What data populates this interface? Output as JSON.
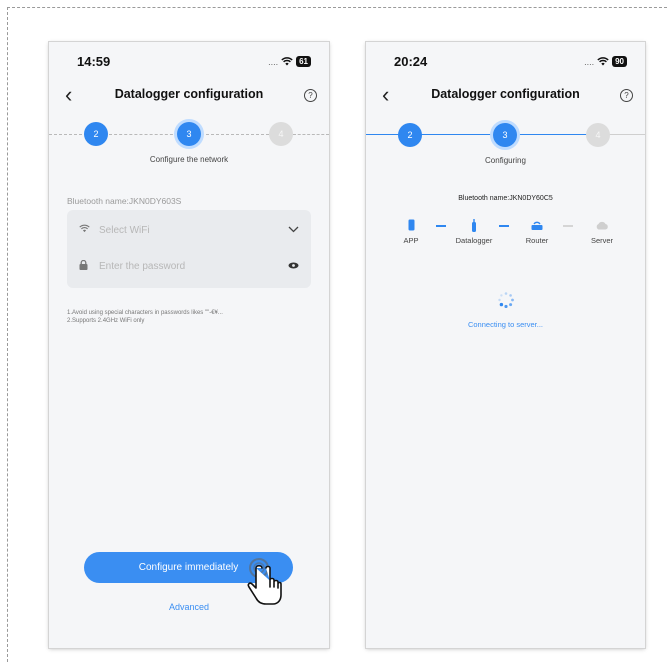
{
  "left_phone": {
    "status_time": "14:59",
    "battery": "61",
    "title": "Datalogger configuration",
    "steps": [
      "2",
      "3",
      "4"
    ],
    "step_label": "Configure the network",
    "bluetooth_name": "Bluetooth name:JKN0DY603S",
    "wifi_placeholder": "Select WiFi",
    "password_placeholder": "Enter the password",
    "note_line1": "1.Avoid using special characters in passwords likes \"\"-€¥...",
    "note_line2": "2.Supports 2.4GHz WiFi only",
    "configure_button": "Configure immediately",
    "advanced_link": "Advanced"
  },
  "right_phone": {
    "status_time": "20:24",
    "battery": "90",
    "title": "Datalogger configuration",
    "steps": [
      "2",
      "3",
      "4"
    ],
    "step_label": "Configuring",
    "bluetooth_name": "Bluetooth name:JKN0DY60C5",
    "nodes": [
      "APP",
      "Datalogger",
      "Router",
      "Server"
    ],
    "connecting_text": "Connecting to server..."
  },
  "colors": {
    "accent": "#2f87f0",
    "inactive": "#dcdcdc"
  },
  "icons": [
    "chevron-left-icon",
    "help-icon",
    "wifi-icon",
    "lock-icon",
    "chevron-down-icon",
    "eye-icon",
    "phone-icon",
    "datalogger-icon",
    "router-icon",
    "cloud-icon",
    "spinner-icon",
    "hand-cursor-icon"
  ]
}
